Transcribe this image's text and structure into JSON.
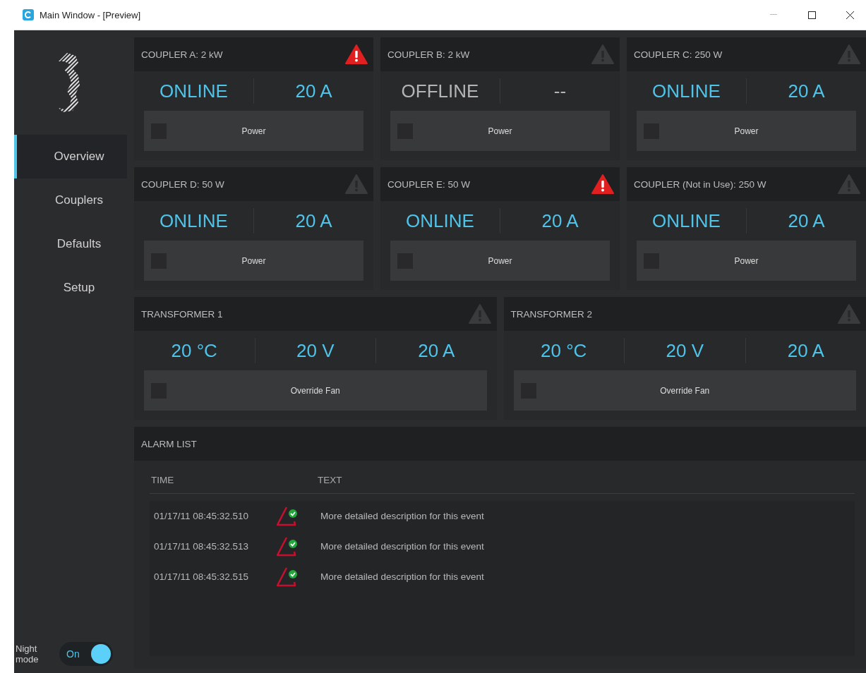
{
  "window": {
    "title": "Main Window - [Preview]"
  },
  "sidebar": {
    "items": [
      {
        "label": "Overview",
        "selected": true
      },
      {
        "label": "Couplers",
        "selected": false
      },
      {
        "label": "Defaults",
        "selected": false
      },
      {
        "label": "Setup",
        "selected": false
      }
    ],
    "night_mode": {
      "label": "Night mode",
      "toggle_label": "On",
      "on": true
    }
  },
  "couplers": [
    {
      "title": "COUPLER A: 2 kW",
      "alert": true,
      "online": true,
      "status": "ONLINE",
      "current": "20 A",
      "power": {
        "label": "Power",
        "checked": false
      }
    },
    {
      "title": "COUPLER B: 2 kW",
      "alert": false,
      "online": false,
      "status": "OFFLINE",
      "current": "--",
      "power": {
        "label": "Power",
        "checked": false
      }
    },
    {
      "title": "COUPLER C: 250 W",
      "alert": false,
      "online": true,
      "status": "ONLINE",
      "current": "20 A",
      "power": {
        "label": "Power",
        "checked": false
      }
    },
    {
      "title": "COUPLER D: 50 W",
      "alert": false,
      "online": true,
      "status": "ONLINE",
      "current": "20 A",
      "power": {
        "label": "Power",
        "checked": false
      }
    },
    {
      "title": "COUPLER E: 50 W",
      "alert": true,
      "online": true,
      "status": "ONLINE",
      "current": "20 A",
      "power": {
        "label": "Power",
        "checked": false
      }
    },
    {
      "title": "COUPLER (Not in Use): 250 W",
      "alert": false,
      "online": true,
      "status": "ONLINE",
      "current": "20 A",
      "power": {
        "label": "Power",
        "checked": false
      }
    }
  ],
  "transformers": [
    {
      "title": "TRANSFORMER 1",
      "alert": false,
      "readings": [
        "20 °C",
        "20 V",
        "20 A"
      ],
      "fan": {
        "label": "Override Fan",
        "checked": false
      }
    },
    {
      "title": "TRANSFORMER 2",
      "alert": false,
      "readings": [
        "20 °C",
        "20 V",
        "20 A"
      ],
      "fan": {
        "label": "Override Fan",
        "checked": false
      }
    }
  ],
  "alarm_list": {
    "title": "ALARM LIST",
    "columns": [
      "TIME",
      "TEXT"
    ],
    "rows": [
      {
        "time": "01/17/11 08:45:32.510",
        "text": "More detailed description for this event"
      },
      {
        "time": "01/17/11 08:45:32.513",
        "text": "More detailed description for this event"
      },
      {
        "time": "01/17/11 08:45:32.515",
        "text": "More detailed description for this event"
      }
    ]
  }
}
